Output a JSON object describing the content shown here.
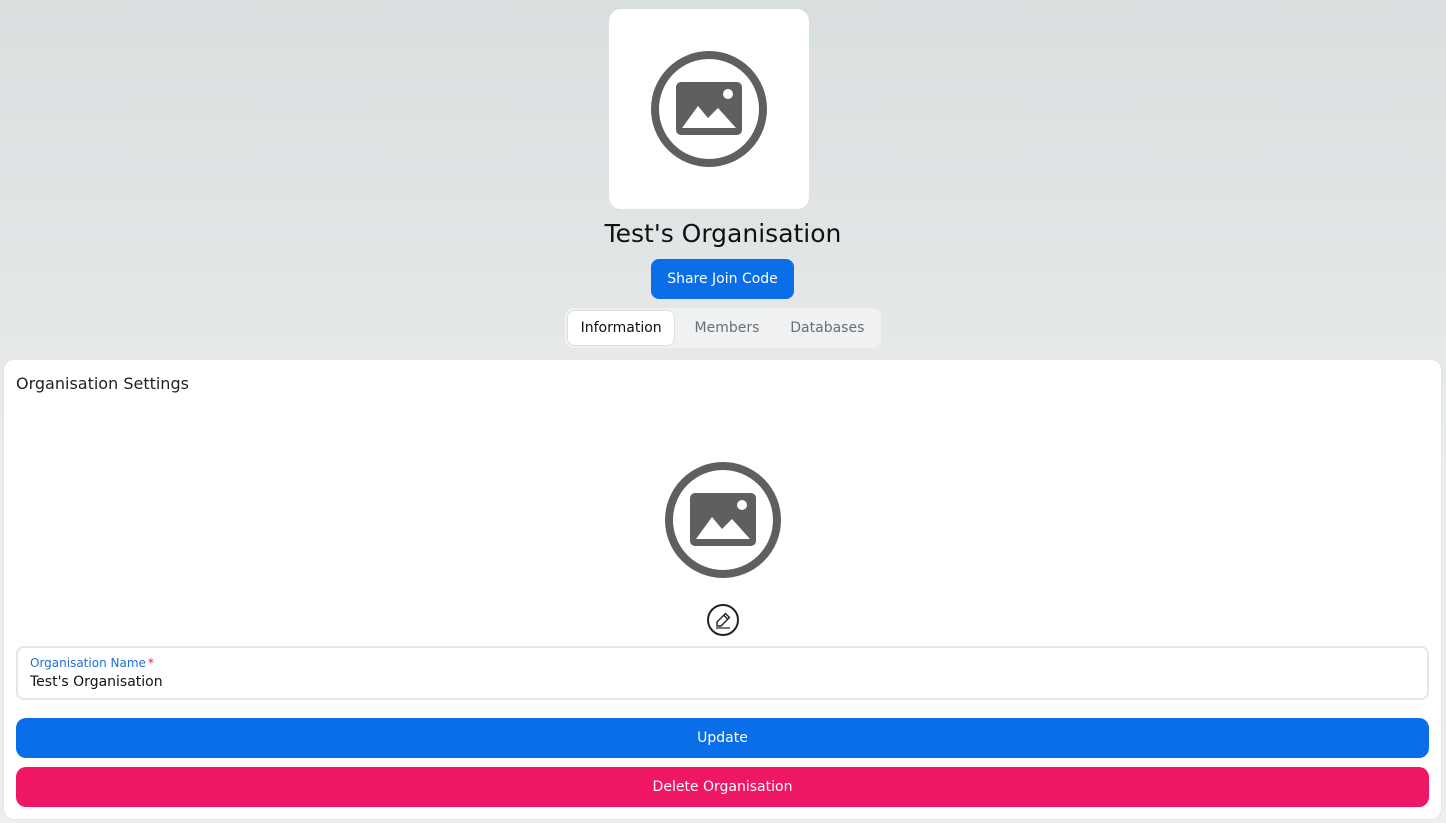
{
  "organisation": {
    "name": "Test's Organisation",
    "logo_icon": "image-placeholder-icon",
    "share_button_label": "Share Join Code"
  },
  "tabs": [
    {
      "label": "Information",
      "active": true
    },
    {
      "label": "Members",
      "active": false
    },
    {
      "label": "Databases",
      "active": false
    }
  ],
  "settings": {
    "title": "Organisation Settings",
    "logo_icon": "image-placeholder-icon",
    "edit_icon": "pencil-icon",
    "name_field": {
      "label": "Organisation Name",
      "required_marker": "*",
      "value": "Test's Organisation"
    },
    "update_label": "Update",
    "delete_label": "Delete Organisation"
  },
  "colors": {
    "primary": "#0a6ee8",
    "danger": "#f01666",
    "icon_gray": "#5f5f5f"
  }
}
